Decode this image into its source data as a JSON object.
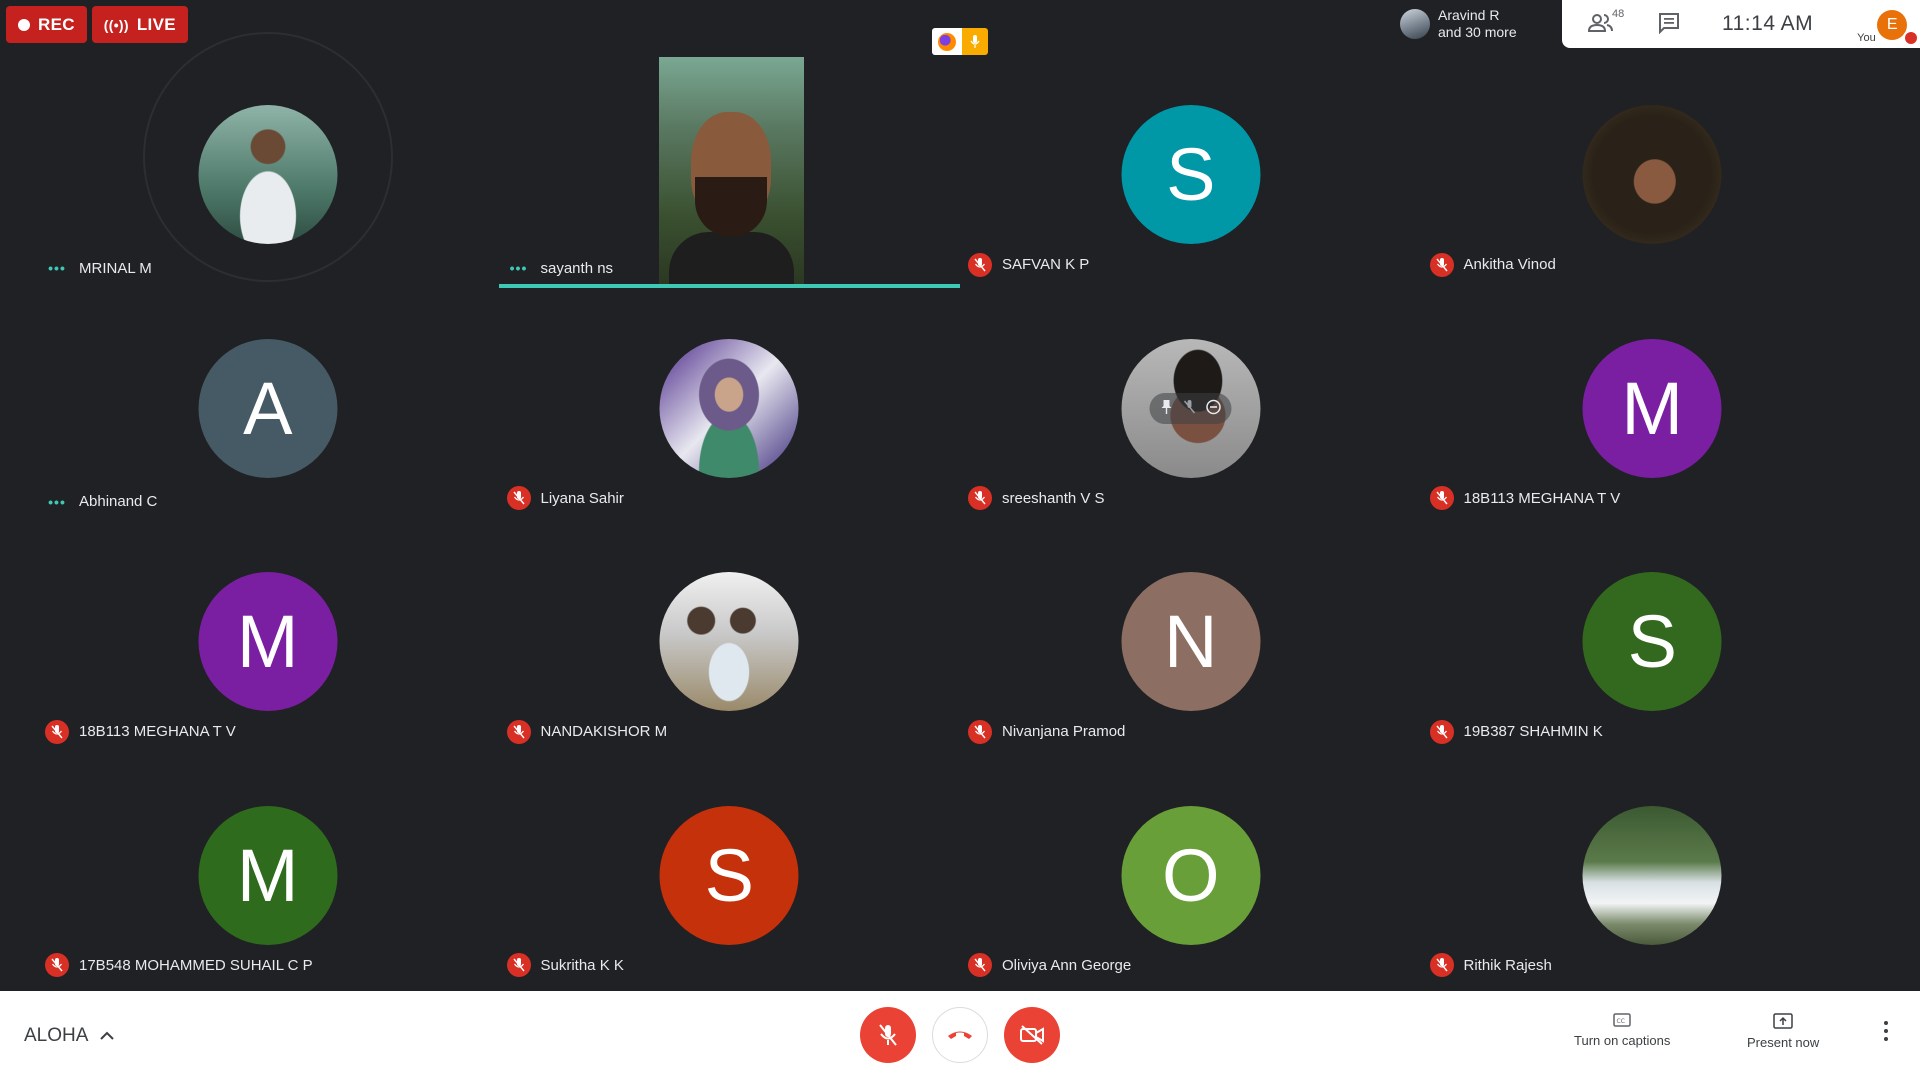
{
  "topbar": {
    "rec_label": "REC",
    "live_label": "LIVE",
    "presenter_line1": "Aravind R",
    "presenter_line2": "and 30 more",
    "people_count": "48",
    "time": "11:14 AM",
    "you_initial": "E",
    "you_label": "You"
  },
  "tiles": [
    {
      "name": "MRINAL M",
      "status": "speaking-dots",
      "avatar": "photo",
      "icon": "person-photo"
    },
    {
      "name": "sayanth ns",
      "status": "speaking-dots",
      "avatar": "video",
      "icon": "camera-video"
    },
    {
      "name": "SAFVAN K P",
      "status": "muted",
      "avatar": "letter",
      "letter": "S",
      "color": "#0097a7"
    },
    {
      "name": "Ankitha Vinod",
      "status": "muted",
      "avatar": "photo",
      "icon": "person-photo"
    },
    {
      "name": "Abhinand C",
      "status": "speaking-dots",
      "avatar": "letter",
      "letter": "A",
      "color": "#455a64"
    },
    {
      "name": "Liyana Sahir",
      "status": "muted",
      "avatar": "photo",
      "icon": "person-photo"
    },
    {
      "name": "sreeshanth V S",
      "status": "muted",
      "avatar": "photo",
      "icon": "person-photo"
    },
    {
      "name": "18B113 MEGHANA T V",
      "status": "muted",
      "avatar": "letter",
      "letter": "M",
      "color": "#7b1fa2"
    },
    {
      "name": "18B113 MEGHANA T V",
      "status": "muted",
      "avatar": "letter",
      "letter": "M",
      "color": "#7b1fa2"
    },
    {
      "name": "NANDAKISHOR M",
      "status": "muted",
      "avatar": "photo",
      "icon": "group-photo"
    },
    {
      "name": "Nivanjana Pramod",
      "status": "muted",
      "avatar": "letter",
      "letter": "N",
      "color": "#8d6e63"
    },
    {
      "name": "19B387 SHAHMIN K",
      "status": "muted",
      "avatar": "letter",
      "letter": "S",
      "color": "#33691e"
    },
    {
      "name": "17B548 MOHAMMED SUHAIL C P",
      "status": "muted",
      "avatar": "letter",
      "letter": "M",
      "color": "#2e6b1d"
    },
    {
      "name": "Sukritha K K",
      "status": "muted",
      "avatar": "letter",
      "letter": "S",
      "color": "#c5310b"
    },
    {
      "name": "Oliviya Ann George",
      "status": "muted",
      "avatar": "letter",
      "letter": "O",
      "color": "#689f38"
    },
    {
      "name": "Rithik Rajesh",
      "status": "muted",
      "avatar": "photo",
      "icon": "waterfall-photo"
    }
  ],
  "bottom": {
    "meeting_name": "ALOHA",
    "captions_label": "Turn on captions",
    "present_label": "Present now"
  },
  "colors": {
    "background": "#202124",
    "mute_red": "#d93025",
    "speaking_teal": "#3ec9b6",
    "control_red": "#ea4335"
  }
}
